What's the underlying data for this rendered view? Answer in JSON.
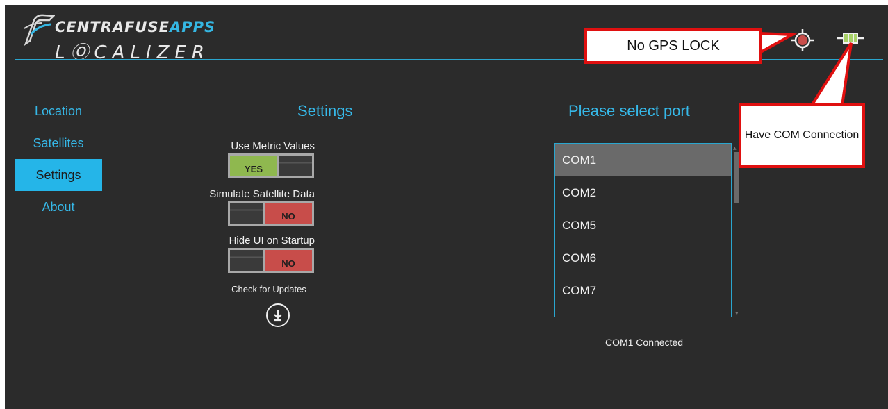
{
  "header": {
    "logo_top_main": "CENTRAFUSE",
    "logo_top_accent": "APPS",
    "logo_bottom": "LⓄCALIZER"
  },
  "sidebar": {
    "items": [
      {
        "label": "Location",
        "active": false
      },
      {
        "label": "Satellites",
        "active": false
      },
      {
        "label": "Settings",
        "active": true
      },
      {
        "label": "About",
        "active": false
      }
    ]
  },
  "settings": {
    "title": "Settings",
    "options": [
      {
        "label": "Use Metric Values",
        "value": "YES"
      },
      {
        "label": "Simulate Satellite Data",
        "value": "NO"
      },
      {
        "label": "Hide UI on Startup",
        "value": "NO"
      }
    ],
    "check_updates_label": "Check for Updates"
  },
  "ports": {
    "title": "Please select port",
    "items": [
      "COM1",
      "COM2",
      "COM5",
      "COM6",
      "COM7"
    ],
    "selected": "COM1",
    "status": "COM1 Connected"
  },
  "annotations": {
    "gps_callout": "No GPS LOCK",
    "com_callout": "Have COM Connection"
  },
  "icons": {
    "gps": "gps-crosshair-icon",
    "com": "com-connection-icon",
    "update": "download-circle-icon"
  },
  "colors": {
    "accent": "#36b8e8",
    "background": "#2b2b2b",
    "yes": "#8fb84f",
    "no": "#c84d4a",
    "callout_border": "#e01010",
    "gps_status": "#c84d4a",
    "com_status": "#a8d168"
  }
}
